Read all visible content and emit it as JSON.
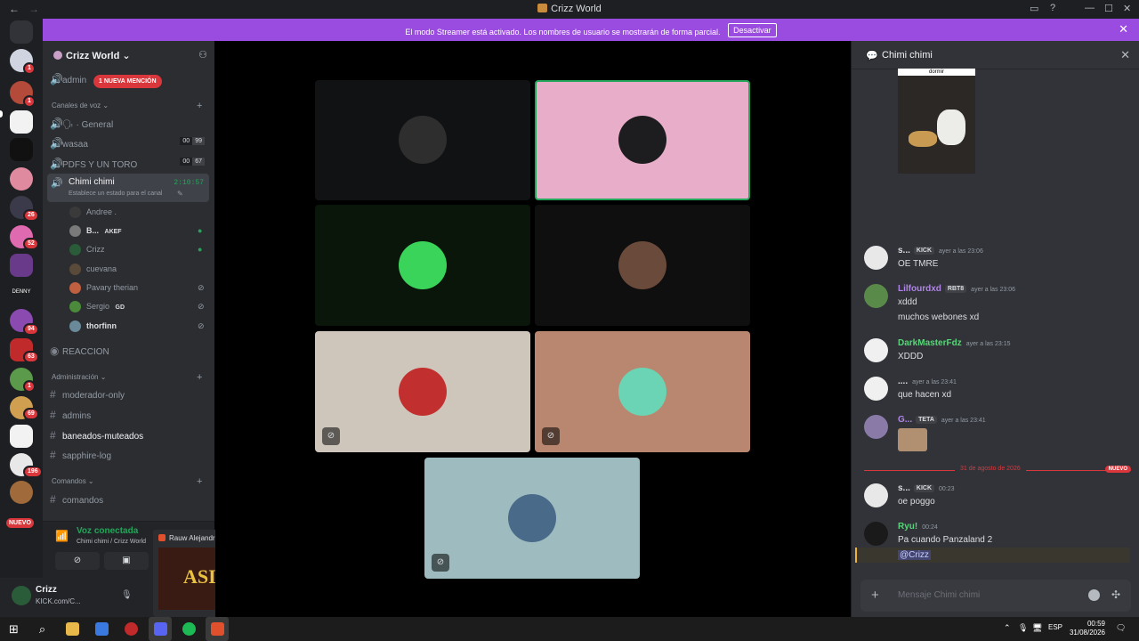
{
  "window": {
    "title": "Crizz World"
  },
  "banner": {
    "text": "El modo Streamer está activado. Los nombres de usuario se mostrarán de forma parcial.",
    "button": "Desactivar"
  },
  "servers": {
    "badges": [
      "1",
      "1",
      "26",
      "52",
      "94",
      "63",
      "1",
      "69",
      "196"
    ],
    "new_label": "NUEVO"
  },
  "guild": {
    "name": "Crizz World",
    "mention_pill": "1 NUEVA MENCIÓN",
    "top_channel": "admin",
    "categories": {
      "voice": "Canales de voz",
      "admin": "Administración",
      "commands": "Comandos"
    },
    "voice_channels": [
      {
        "name": "General",
        "prefix": "🗣 ·"
      },
      {
        "name": "wasaa",
        "count_a": "00",
        "count_b": "99"
      },
      {
        "name": "PDFS Y UN TORO",
        "count_a": "00",
        "count_b": "67"
      }
    ],
    "active_channel": {
      "name": "Chimi chimi",
      "timer": "2:10:57",
      "status": "Establece un estado para el canal"
    },
    "voice_users": [
      {
        "name": "Andree .",
        "tag": "",
        "color": "#3a3a3a",
        "indicator": ""
      },
      {
        "name": "B...",
        "tag": "AKEF",
        "color": "#7a7a7a",
        "indicator": "●"
      },
      {
        "name": "Crizz",
        "tag": "",
        "color": "#2b5c3a",
        "indicator": "●"
      },
      {
        "name": "cuevana",
        "tag": "",
        "color": "#5a4a3a",
        "indicator": ""
      },
      {
        "name": "Pavary therian",
        "tag": "",
        "color": "#c06040",
        "indicator": "⊘"
      },
      {
        "name": "Sergio",
        "tag": "GD",
        "color": "#4a8a3a",
        "indicator": "⊘"
      },
      {
        "name": "thorfinn",
        "tag": "",
        "color": "#6a8a9a",
        "indicator": "⊘"
      }
    ],
    "reaction_channel": "REACCION",
    "admin_channels": [
      "moderador-only",
      "admins",
      "baneados-muteados",
      "sapphire-log"
    ],
    "command_channels": [
      "comandos"
    ]
  },
  "voice_panel": {
    "state": "Voz conectada",
    "location": "Chimi chimi / Crizz World"
  },
  "user_panel": {
    "name": "Crizz",
    "status": "KICK.com/C..."
  },
  "thumbnail": {
    "title": "Rauw Alejandro ✕ Chencho Cor...",
    "image_text": "ASI"
  },
  "tiles": [
    {
      "bg": "#111214",
      "avatar": "#2e2e2e",
      "muted": false,
      "selected": false
    },
    {
      "bg": "#e8aec9",
      "avatar": "#1d1d1f",
      "muted": false,
      "selected": true
    },
    {
      "bg": "#0a160a",
      "avatar": "#3ad45a",
      "muted": false,
      "selected": false
    },
    {
      "bg": "#0f0f0f",
      "avatar": "#6a4a3a",
      "muted": false,
      "selected": false
    },
    {
      "bg": "#cfc6bb",
      "avatar": "#c22f2f",
      "muted": true,
      "selected": false
    },
    {
      "bg": "#b9876f",
      "avatar": "#6ad4b4",
      "muted": true,
      "selected": false
    },
    {
      "bg": "#9ebbbf",
      "avatar": "#4a6a8a",
      "muted": true,
      "selected": false
    }
  ],
  "chat": {
    "channel": "Chimi chimi",
    "image_caption": "dormir",
    "messages": [
      {
        "user": "s...",
        "tag": "KICK",
        "time": "ayer a las 23:06",
        "lines": [
          "OE TMRE"
        ],
        "color": "#dbdee1",
        "avatar": "#e8e8e8"
      },
      {
        "user": "Lilfourdxd",
        "tag": "RBT8",
        "time": "ayer a las 23:06",
        "lines": [
          "xddd",
          "muchos webones xd"
        ],
        "color": "#b084e8",
        "avatar": "#5a8a4a"
      },
      {
        "user": "DarkMasterFdz",
        "tag": "",
        "time": "ayer a las 23:15",
        "lines": [
          "XDDD"
        ],
        "color": "#5ad47a",
        "avatar": "#f0f0f0"
      },
      {
        "user": "....",
        "tag": "",
        "time": "ayer a las 23:41",
        "lines": [
          "que hacen xd"
        ],
        "color": "#dbdee1",
        "avatar": "#f0f0f0"
      },
      {
        "user": "G...",
        "tag": "TETA",
        "time": "ayer a las 23:41",
        "lines": [
          ""
        ],
        "color": "#b084e8",
        "avatar": "#8a7aa8"
      }
    ],
    "divider": {
      "date": "31 de agosto de 2026",
      "new": "NUEVO"
    },
    "messages_new": [
      {
        "user": "s...",
        "tag": "KICK",
        "time": "00:23",
        "lines": [
          "oe poggo"
        ],
        "color": "#dbdee1",
        "avatar": "#e8e8e8"
      },
      {
        "user": "Ryu!",
        "tag": "",
        "time": "00:24",
        "lines": [
          "Pa cuando Panzaland 2"
        ],
        "color": "#5ad47a",
        "avatar": "#1a1a1a"
      }
    ],
    "mention": "@Crizz",
    "placeholder": "Mensaje Chimi chimi"
  },
  "taskbar": {
    "lang": "ESP",
    "time": "00:59",
    "date": "31/08/2026"
  }
}
